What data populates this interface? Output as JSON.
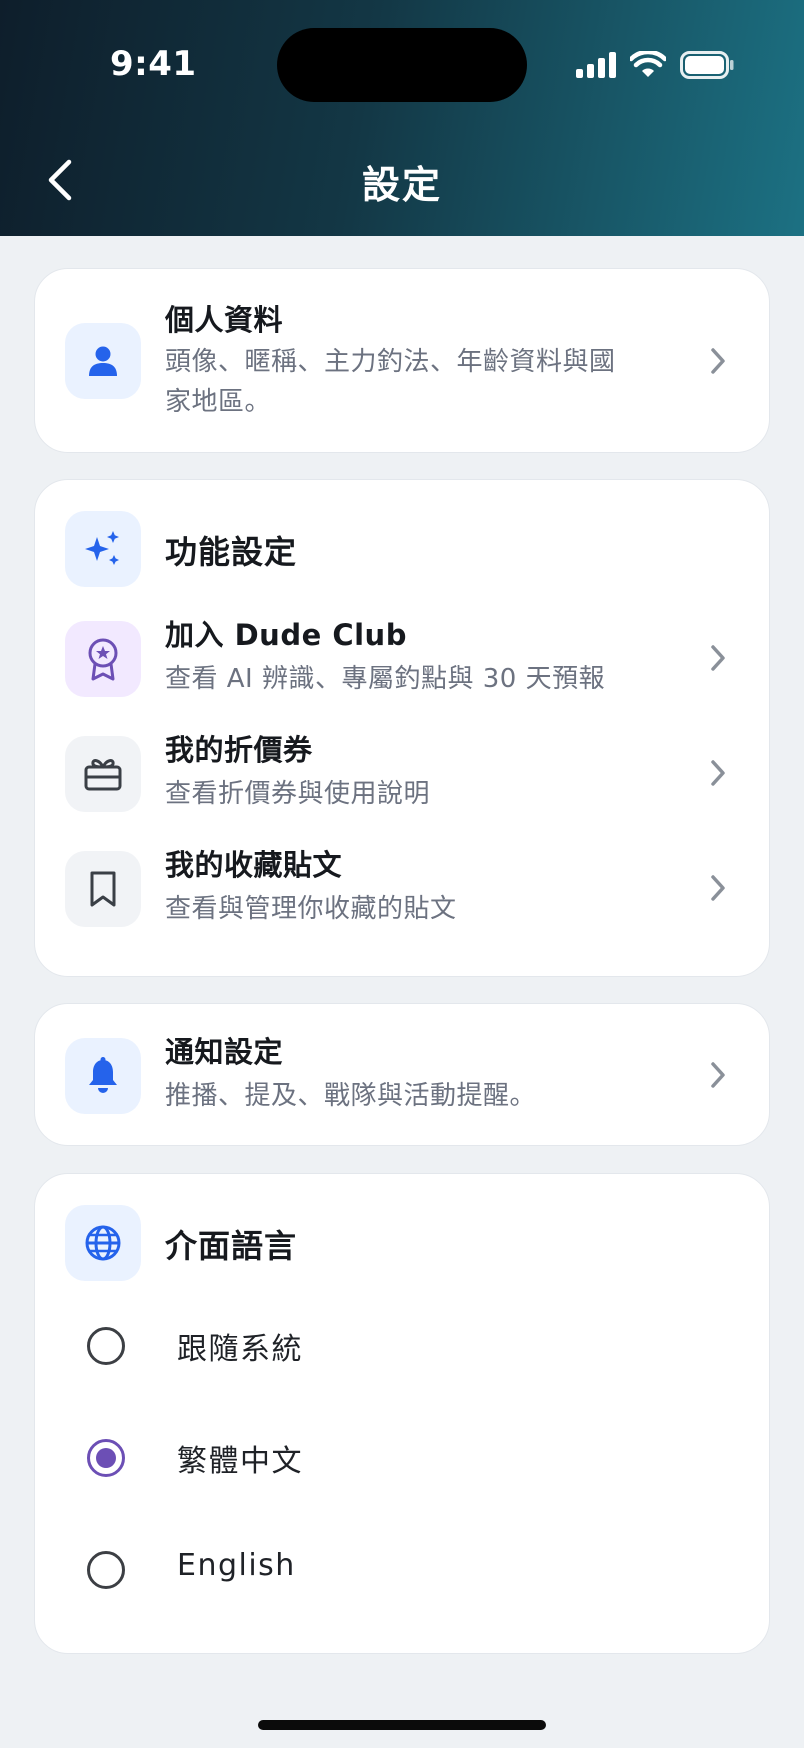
{
  "status_bar": {
    "time": "9:41"
  },
  "header": {
    "title": "設定"
  },
  "profile": {
    "title": "個人資料",
    "subtitle_line1": "頭像、暱稱、主力釣法、年齡資料與國",
    "subtitle_line2": "家地區。"
  },
  "features": {
    "section_title": "功能設定",
    "items": [
      {
        "title": "加入 Dude Club",
        "subtitle": "查看 AI 辨識、專屬釣點與 30 天預報"
      },
      {
        "title": "我的折價券",
        "subtitle": "查看折價券與使用說明"
      },
      {
        "title": "我的收藏貼文",
        "subtitle": "查看與管理你收藏的貼文"
      }
    ]
  },
  "notifications": {
    "title": "通知設定",
    "subtitle": "推播、提及、戰隊與活動提醒。"
  },
  "language": {
    "section_title": "介面語言",
    "options": [
      {
        "label": "跟隨系統",
        "selected": false
      },
      {
        "label": "繁體中文",
        "selected": true
      },
      {
        "label": "English",
        "selected": false
      }
    ]
  },
  "colors": {
    "accent_blue": "#2563eb",
    "accent_purple": "#6c4fb5",
    "header_gradient_start": "#0e1e2b",
    "header_gradient_end": "#1c7183"
  }
}
